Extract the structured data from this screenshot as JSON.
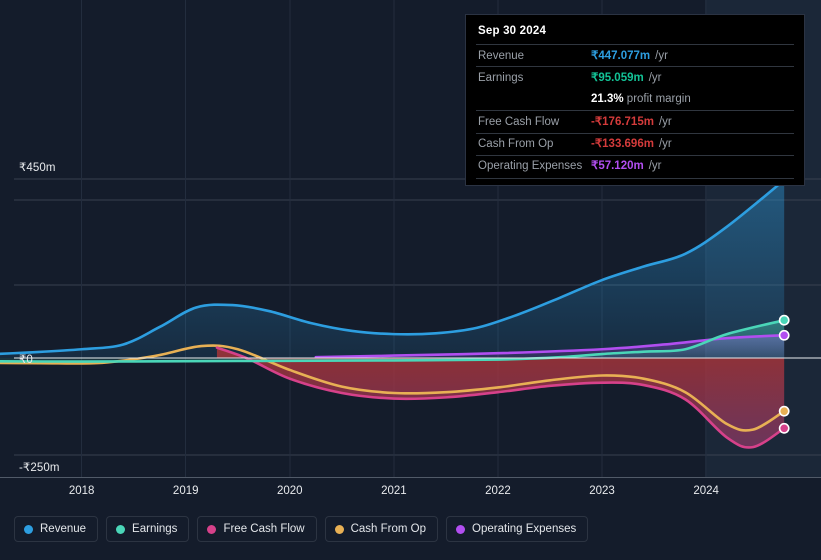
{
  "chart_data": {
    "type": "area",
    "title": "",
    "xlabel": "",
    "ylabel": "",
    "currency": "₹",
    "units": "m",
    "ylim": [
      -250,
      450
    ],
    "y_ticks": [
      {
        "label": "₹450m",
        "value": 450
      },
      {
        "label": "₹0",
        "value": 0
      },
      {
        "label": "-₹250m",
        "value": -250
      }
    ],
    "x_ticks": [
      "2018",
      "2019",
      "2020",
      "2021",
      "2022",
      "2023",
      "2024"
    ],
    "grid": true,
    "legend_position": "bottom",
    "series": [
      {
        "name": "Revenue",
        "color": "#2d9ee0",
        "last_value": 447.077,
        "points": [
          [
            2017.0,
            8
          ],
          [
            2017.5,
            14
          ],
          [
            2018.0,
            22
          ],
          [
            2018.4,
            34
          ],
          [
            2018.75,
            78
          ],
          [
            2019.1,
            127
          ],
          [
            2019.45,
            133
          ],
          [
            2019.8,
            118
          ],
          [
            2020.2,
            88
          ],
          [
            2020.6,
            68
          ],
          [
            2021.0,
            60
          ],
          [
            2021.4,
            62
          ],
          [
            2021.8,
            76
          ],
          [
            2022.2,
            110
          ],
          [
            2022.6,
            152
          ],
          [
            2023.0,
            196
          ],
          [
            2023.4,
            230
          ],
          [
            2023.8,
            262
          ],
          [
            2024.2,
            330
          ],
          [
            2024.75,
            447.077
          ]
        ]
      },
      {
        "name": "Earnings",
        "color": "#4ad6b8",
        "last_value": 95.059,
        "points": [
          [
            2017.0,
            -8
          ],
          [
            2018.0,
            -9
          ],
          [
            2019.0,
            -8
          ],
          [
            2020.0,
            -7
          ],
          [
            2021.0,
            -6
          ],
          [
            2022.0,
            -4
          ],
          [
            2022.6,
            2
          ],
          [
            2023.0,
            10
          ],
          [
            2023.4,
            16
          ],
          [
            2023.8,
            22
          ],
          [
            2024.2,
            60
          ],
          [
            2024.75,
            95.059
          ]
        ]
      },
      {
        "name": "Free Cash Flow",
        "color": "#d6418a",
        "last_value": -176.715,
        "points": [
          [
            2019.3,
            26
          ],
          [
            2019.6,
            -2
          ],
          [
            2020.0,
            -52
          ],
          [
            2020.5,
            -88
          ],
          [
            2021.0,
            -102
          ],
          [
            2021.5,
            -99
          ],
          [
            2022.0,
            -86
          ],
          [
            2022.5,
            -70
          ],
          [
            2023.0,
            -62
          ],
          [
            2023.4,
            -68
          ],
          [
            2023.8,
            -104
          ],
          [
            2024.2,
            -200
          ],
          [
            2024.45,
            -224
          ],
          [
            2024.75,
            -176.715
          ]
        ]
      },
      {
        "name": "Cash From Op",
        "color": "#e8b054",
        "last_value": -133.696,
        "points": [
          [
            2017.0,
            -12
          ],
          [
            2017.6,
            -13
          ],
          [
            2018.2,
            -12
          ],
          [
            2018.7,
            5
          ],
          [
            2019.15,
            30
          ],
          [
            2019.5,
            22
          ],
          [
            2020.0,
            -30
          ],
          [
            2020.5,
            -72
          ],
          [
            2021.0,
            -88
          ],
          [
            2021.5,
            -86
          ],
          [
            2022.0,
            -74
          ],
          [
            2022.5,
            -56
          ],
          [
            2023.0,
            -44
          ],
          [
            2023.4,
            -52
          ],
          [
            2023.8,
            -86
          ],
          [
            2024.2,
            -166
          ],
          [
            2024.45,
            -180
          ],
          [
            2024.75,
            -133.696
          ]
        ]
      },
      {
        "name": "Operating Expenses",
        "color": "#b14ef0",
        "last_value": 57.12,
        "points": [
          [
            2020.25,
            2
          ],
          [
            2021.0,
            6
          ],
          [
            2022.0,
            12
          ],
          [
            2023.0,
            22
          ],
          [
            2023.6,
            34
          ],
          [
            2024.2,
            50
          ],
          [
            2024.75,
            57.12
          ]
        ]
      }
    ]
  },
  "tooltip": {
    "date": "Sep 30 2024",
    "rows": [
      {
        "key": "Revenue",
        "value": "₹447.077m",
        "unit": "/yr",
        "color": "#2d9ee0"
      },
      {
        "key": "Earnings",
        "value": "₹95.059m",
        "unit": "/yr",
        "color": "#13c296"
      },
      {
        "key": "Free Cash Flow",
        "value": "-₹176.715m",
        "unit": "/yr",
        "color": "#d43b3b"
      },
      {
        "key": "Cash From Op",
        "value": "-₹133.696m",
        "unit": "/yr",
        "color": "#d43b3b"
      },
      {
        "key": "Operating Expenses",
        "value": "₹57.120m",
        "unit": "/yr",
        "color": "#b14ef0"
      }
    ],
    "margin_value": "21.3%",
    "margin_label": "profit margin"
  },
  "axis": {
    "y_top": "₹450m",
    "y_zero": "₹0",
    "y_bottom": "-₹250m",
    "x_labels": [
      "2018",
      "2019",
      "2020",
      "2021",
      "2022",
      "2023",
      "2024"
    ]
  },
  "legend": {
    "items": [
      {
        "label": "Revenue",
        "color": "#2d9ee0"
      },
      {
        "label": "Earnings",
        "color": "#4ad6b8"
      },
      {
        "label": "Free Cash Flow",
        "color": "#d6418a"
      },
      {
        "label": "Cash From Op",
        "color": "#e8b054"
      },
      {
        "label": "Operating Expenses",
        "color": "#b14ef0"
      }
    ]
  }
}
